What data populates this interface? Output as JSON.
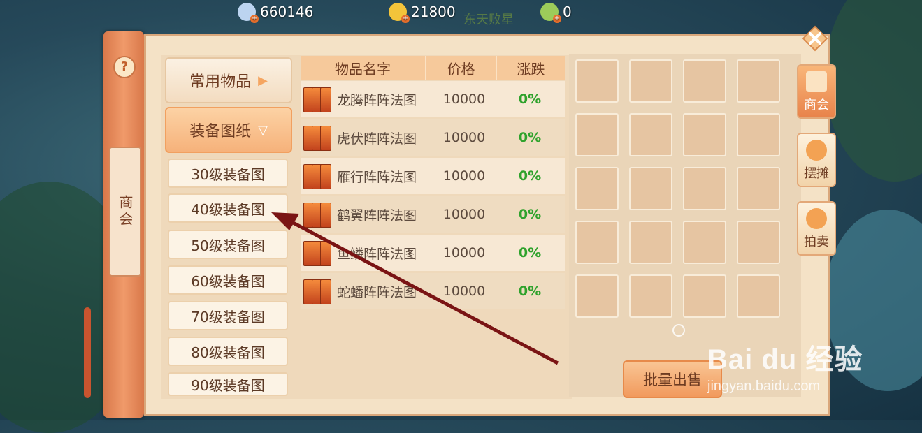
{
  "currencies": [
    {
      "name": "silver-coin-icon",
      "value": "660146",
      "color": "#bcd4f0"
    },
    {
      "name": "gold-coin-icon",
      "value": "21800",
      "color": "#f3c43a"
    },
    {
      "name": "jade-coin-icon",
      "value": "0",
      "color": "#9ccc5a"
    }
  ],
  "top_faded_text": "东天败星",
  "side_scroll": {
    "title": "商会",
    "help": "?"
  },
  "categories": [
    {
      "label": "常用物品",
      "arrow": "▶",
      "state": "normal"
    },
    {
      "label": "装备图纸",
      "arrow": "▽",
      "state": "active"
    }
  ],
  "subcategories": [
    "30级装备图",
    "40级装备图",
    "50级装备图",
    "60级装备图",
    "70级装备图",
    "80级装备图",
    "90级装备图"
  ],
  "table": {
    "headers": [
      "物品名字",
      "价格",
      "涨跌"
    ],
    "rows": [
      {
        "name": "龙腾阵阵法图",
        "price": "10000",
        "change": "0%"
      },
      {
        "name": "虎伏阵阵法图",
        "price": "10000",
        "change": "0%"
      },
      {
        "name": "雁行阵阵法图",
        "price": "10000",
        "change": "0%"
      },
      {
        "name": "鹤翼阵阵法图",
        "price": "10000",
        "change": "0%"
      },
      {
        "name": "鱼鳞阵阵法图",
        "price": "10000",
        "change": "0%"
      },
      {
        "name": "蛇蟠阵阵法图",
        "price": "10000",
        "change": "0%"
      }
    ]
  },
  "inventory": {
    "rows": 5,
    "cols": 4
  },
  "batch_sell_label": "批量出售",
  "right_tabs": [
    {
      "label": "商会",
      "icon": "guild-icon",
      "active": true
    },
    {
      "label": "摆摊",
      "icon": "stall-icon",
      "active": false
    },
    {
      "label": "拍卖",
      "icon": "auction-icon",
      "active": false
    }
  ],
  "watermark": {
    "brand": "Bai du 经验",
    "url": "jingyan.baidu.com"
  },
  "colors": {
    "accent": "#f6b27b",
    "change_positive": "#2fa22c",
    "arrow": "#7a1414"
  }
}
